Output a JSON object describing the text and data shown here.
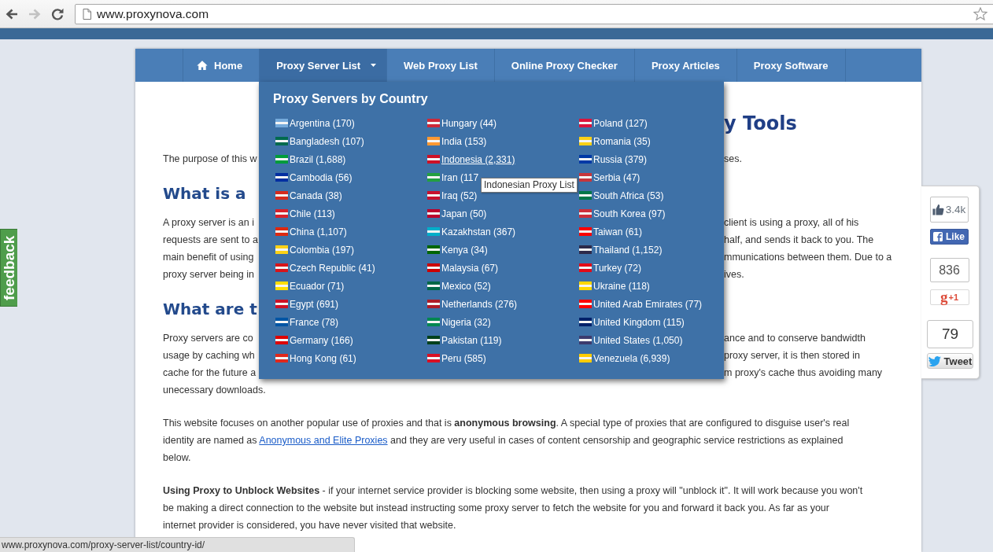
{
  "browser": {
    "buttons": [
      {
        "kind": "back",
        "disabled": false
      },
      {
        "kind": "forward",
        "disabled": true
      },
      {
        "kind": "reload",
        "disabled": false
      }
    ],
    "url": "www.proxynova.com",
    "bookmarked": false
  },
  "nav": {
    "items": [
      {
        "kind": "home",
        "label": "Home",
        "selected": false
      },
      {
        "kind": "dropdown",
        "label": "Proxy Server List",
        "selected": true
      },
      {
        "kind": "link",
        "label": "Web Proxy List",
        "selected": false
      },
      {
        "kind": "link",
        "label": "Online Proxy Checker",
        "selected": false
      },
      {
        "kind": "link",
        "label": "Proxy Articles",
        "selected": false
      },
      {
        "kind": "link",
        "label": "Proxy Software",
        "selected": false
      }
    ]
  },
  "dropdown": {
    "title": "Proxy Servers by Country",
    "columns": [
      {
        "items": [
          {
            "label": "Argentina (170)",
            "color": "#75aadb",
            "hovered": false
          },
          {
            "label": "Bangladesh (107)",
            "color": "#006a4e",
            "hovered": false
          },
          {
            "label": "Brazil (1,688)",
            "color": "#009c3b",
            "hovered": false
          },
          {
            "label": "Cambodia (56)",
            "color": "#032ea1",
            "hovered": false
          },
          {
            "label": "Canada (38)",
            "color": "#d52b1e",
            "hovered": false
          },
          {
            "label": "Chile (113)",
            "color": "#d8202a",
            "hovered": false
          },
          {
            "label": "China (1,107)",
            "color": "#de2910",
            "hovered": false
          },
          {
            "label": "Colombia (197)",
            "color": "#fcd116",
            "hovered": false
          },
          {
            "label": "Czech Republic (41)",
            "color": "#d7141a",
            "hovered": false
          },
          {
            "label": "Ecuador (71)",
            "color": "#ffdd00",
            "hovered": false
          },
          {
            "label": "Egypt (691)",
            "color": "#ce1126",
            "hovered": false
          },
          {
            "label": "France (78)",
            "color": "#0055a4",
            "hovered": false
          },
          {
            "label": "Germany (166)",
            "color": "#dd0000",
            "hovered": false
          },
          {
            "label": "Hong Kong (61)",
            "color": "#e0281c",
            "hovered": false
          }
        ]
      },
      {
        "items": [
          {
            "label": "Hungary (44)",
            "color": "#ce2939",
            "hovered": false
          },
          {
            "label": "India (153)",
            "color": "#ff9933",
            "hovered": false
          },
          {
            "label": "Indonesia (2,331)",
            "color": "#ce1126",
            "hovered": true
          },
          {
            "label": "Iran (117",
            "color": "#239f40",
            "hovered": false
          },
          {
            "label": "Iraq (52)",
            "color": "#c8102e",
            "hovered": false
          },
          {
            "label": "Japan (50)",
            "color": "#bc002d",
            "hovered": false
          },
          {
            "label": "Kazakhstan (367)",
            "color": "#00afca",
            "hovered": false
          },
          {
            "label": "Kenya (34)",
            "color": "#006600",
            "hovered": false
          },
          {
            "label": "Malaysia (67)",
            "color": "#cc0001",
            "hovered": false
          },
          {
            "label": "Mexico (52)",
            "color": "#006847",
            "hovered": false
          },
          {
            "label": "Netherlands (276)",
            "color": "#ae1c28",
            "hovered": false
          },
          {
            "label": "Nigeria (32)",
            "color": "#008751",
            "hovered": false
          },
          {
            "label": "Pakistan (119)",
            "color": "#01411c",
            "hovered": false
          },
          {
            "label": "Peru (585)",
            "color": "#d91023",
            "hovered": false
          }
        ]
      },
      {
        "items": [
          {
            "label": "Poland (127)",
            "color": "#dc143c",
            "hovered": false
          },
          {
            "label": "Romania (35)",
            "color": "#fcd117",
            "hovered": false
          },
          {
            "label": "Russia (379)",
            "color": "#0039a6",
            "hovered": false
          },
          {
            "label": "Serbia (47)",
            "color": "#c6363c",
            "hovered": false
          },
          {
            "label": "South Africa (53)",
            "color": "#007749",
            "hovered": false
          },
          {
            "label": "South Korea (97)",
            "color": "#cd2e3a",
            "hovered": false
          },
          {
            "label": "Taiwan (61)",
            "color": "#fe0000",
            "hovered": false
          },
          {
            "label": "Thailand (1,152)",
            "color": "#2d2a4a",
            "hovered": false
          },
          {
            "label": "Turkey (72)",
            "color": "#e30a17",
            "hovered": false
          },
          {
            "label": "Ukraine (118)",
            "color": "#ffd700",
            "hovered": false
          },
          {
            "label": "United Arab Emirates (77)",
            "color": "#ff0000",
            "hovered": false
          },
          {
            "label": "United Kingdom (115)",
            "color": "#012169",
            "hovered": false
          },
          {
            "label": "United States (1,050)",
            "color": "#3c3b6e",
            "hovered": false
          },
          {
            "label": "Venezuela (6,939)",
            "color": "#ffcc00",
            "hovered": false
          }
        ]
      }
    ],
    "tooltip": "Indonesian Proxy List"
  },
  "article": {
    "blocks": [
      {
        "kind": "title",
        "lines": [
          {
            "right": "y Tools"
          }
        ]
      },
      {
        "kind": "paragraph",
        "lines": [
          {
            "left": "The purpose of this w",
            "right": "ses."
          }
        ]
      },
      {
        "kind": "heading",
        "lines": [
          {
            "left": "What is a"
          }
        ]
      },
      {
        "kind": "paragraph",
        "lines": [
          {
            "left": "A proxy server is an i",
            "right": "client is using a proxy, all of his"
          },
          {
            "left": "requests are sent to a",
            "right": "half, and sends it back to you. The"
          },
          {
            "left": "main benefit of using",
            "right": "mmunications between them. Due to a"
          },
          {
            "left": "proxy server being in",
            "right": "ives."
          }
        ]
      },
      {
        "kind": "heading",
        "lines": [
          {
            "left": "What are t"
          }
        ]
      },
      {
        "kind": "paragraph",
        "lines": [
          {
            "left": "Proxy servers are co",
            "right": "ance and to conserve bandwidth"
          },
          {
            "left": "usage by caching wh",
            "right": "proxy server, it is then stored in"
          },
          {
            "left": "cache for the future a",
            "right": "m proxy's cache thus avoiding many"
          },
          {
            "left": "unecessary downloads."
          }
        ]
      },
      {
        "kind": "rich",
        "text": "This website focuses on another popular use of proxies and that is **anonymous browsing**. A special type of proxies that are configured to disguise user's real identity are named as",
        "link": "Anonymous and Elite Proxies",
        "after": "and they are very useful in cases of content censorship and geographic service restrictions as explained below."
      },
      {
        "kind": "rich",
        "text": "**Using Proxy to Unblock Websites** - if your internet service provider is blocking some website, then using a proxy will \"unblock it\". It will work because you won't be making a direct connection to the website but instead instructing some proxy server to fetch the website for you and forward it back you. As far as your internet provider is considered, you have never visited that website."
      }
    ]
  },
  "social": [
    {
      "kind": "like",
      "count": "3.4k",
      "label": "Like"
    },
    {
      "kind": "plus",
      "count": "836",
      "logo": "g",
      "label": "+1"
    },
    {
      "kind": "tweet",
      "count": "79",
      "label": "Tweet"
    }
  ],
  "feedback": {
    "label": "feedback"
  },
  "status_bar": {
    "url": "www.proxynova.com/proxy-server-list/country-id/"
  }
}
